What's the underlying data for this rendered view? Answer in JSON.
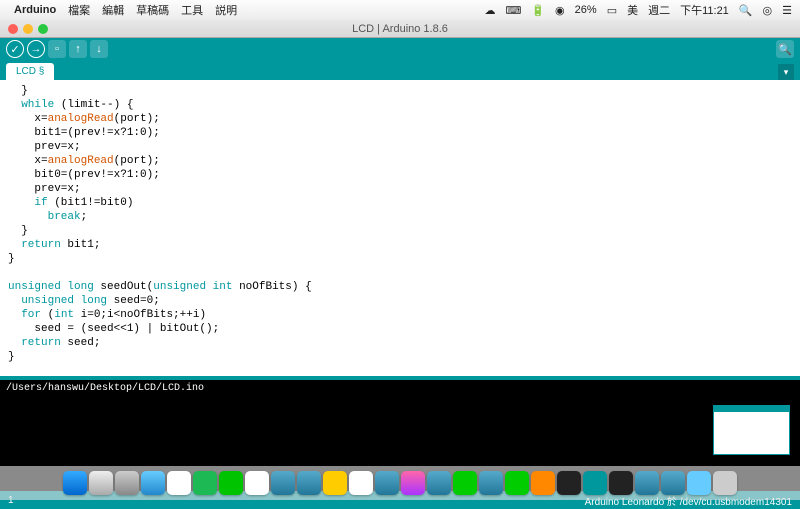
{
  "menubar": {
    "app": "Arduino",
    "items": [
      "檔案",
      "編輯",
      "草稿碼",
      "工具",
      "説明"
    ],
    "battery": "26%",
    "ime": "美",
    "day": "週二",
    "time": "下午11:21"
  },
  "window": {
    "title": "LCD | Arduino 1.8.6"
  },
  "tab": {
    "label": "LCD §"
  },
  "code": {
    "l1": "  }",
    "l2a": "  while",
    "l2b": " (limit--) {",
    "l3a": "    x=",
    "l3b": "analogRead",
    "l3c": "(port);",
    "l4": "    bit1=(prev!=x?1:0);",
    "l5": "    prev=x;",
    "l6a": "    x=",
    "l6b": "analogRead",
    "l6c": "(port);",
    "l7": "    bit0=(prev!=x?1:0);",
    "l8": "    prev=x;",
    "l9a": "    if",
    "l9b": " (bit1!=bit0)",
    "l10a": "      break",
    "l10b": ";",
    "l11": "  }",
    "l12a": "  return",
    "l12b": " bit1;",
    "l13": "}",
    "l14": "",
    "l15a": "unsigned",
    "l15b": " long",
    "l15c": " seedOut(",
    "l15d": "unsigned",
    "l15e": " int",
    "l15f": " noOfBits) {",
    "l16a": "  unsigned",
    "l16b": " long",
    "l16c": " seed=0;",
    "l17a": "  for",
    "l17b": " (",
    "l17c": "int",
    "l17d": " i=0;i<noOfBits;++i)",
    "l18": "    seed = (seed<<1) | bitOut();",
    "l19a": "  return",
    "l19b": " seed;",
    "l20": "}"
  },
  "console": {
    "path": "/Users/hanswu/Desktop/LCD/LCD.ino"
  },
  "status": {
    "line": "1",
    "board": "Arduino Leonardo 於 /dev/cu.usbmodem14301"
  }
}
